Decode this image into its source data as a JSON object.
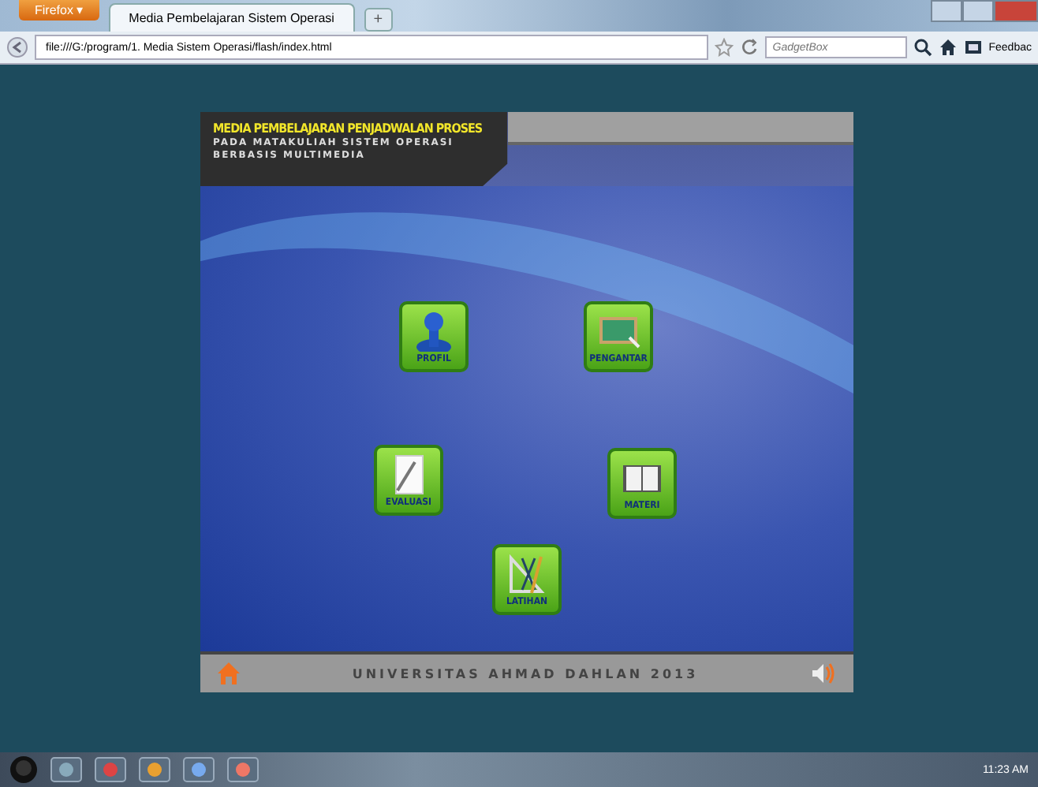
{
  "browser": {
    "app_button": "Firefox ▾",
    "tabs": [
      {
        "label": "Media Pembelajaran Sistem Operasi",
        "selected": true
      }
    ],
    "new_tab": "+",
    "url": "file:///G:/program/1. Media Sistem Operasi/flash/index.html",
    "search_placeholder": "GadgetBox",
    "feedback": "Feedbac"
  },
  "app": {
    "title": "MEDIA PEMBELAJARAN PENJADWALAN PROSES",
    "subtitle": [
      "PADA MATAKULIAH SISTEM OPERASI",
      "BERBASIS MULTIMEDIA"
    ],
    "menu": [
      {
        "label": "PROFIL",
        "kind": "person"
      },
      {
        "label": "PENGANTAR",
        "kind": "board"
      },
      {
        "label": "EVALUASI",
        "kind": "paper"
      },
      {
        "label": "MATERI",
        "kind": "book"
      },
      {
        "label": "LATIHAN",
        "kind": "tools"
      }
    ],
    "footer": "UNIVERSITAS AHMAD DAHLAN 2013"
  },
  "taskbar": {
    "clock": "11:23 AM"
  }
}
